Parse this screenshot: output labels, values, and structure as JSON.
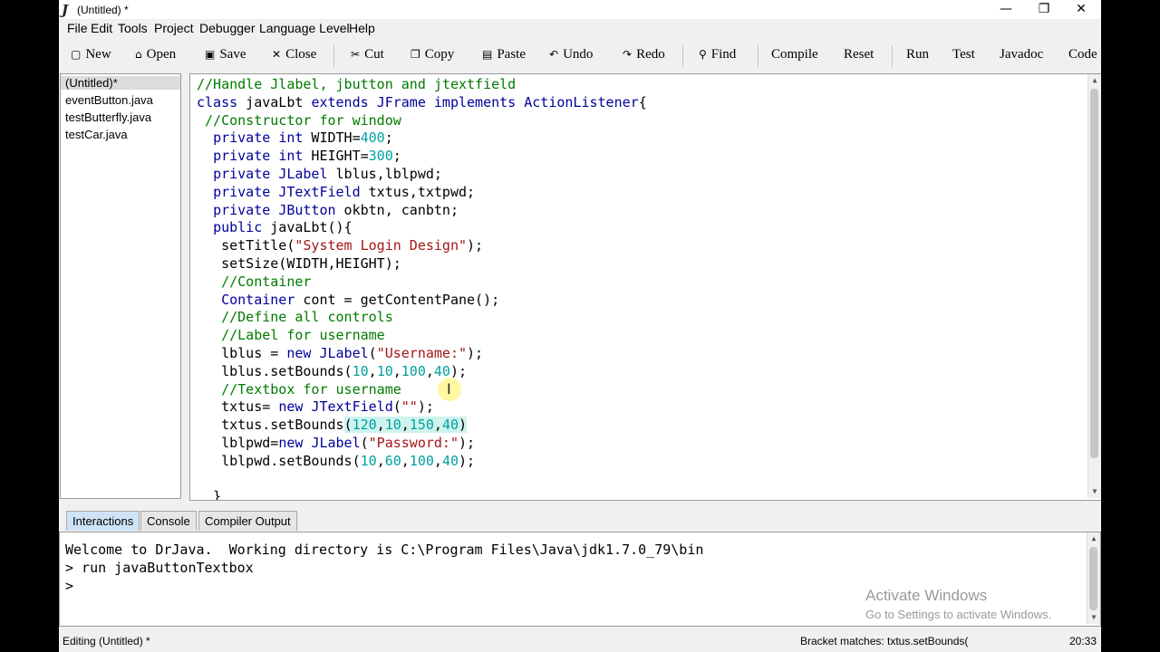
{
  "window": {
    "title": "(Untitled) *",
    "app_icon": "J",
    "controls": {
      "minimize": "—",
      "maximize": "❐",
      "close": "✕"
    }
  },
  "menu": [
    "File",
    "Edit",
    "Tools",
    "Project",
    "Debugger",
    "Language Level",
    "Help"
  ],
  "toolbar": {
    "new": "New",
    "open": "Open",
    "save": "Save",
    "close": "Close",
    "cut": "Cut",
    "copy": "Copy",
    "paste": "Paste",
    "undo": "Undo",
    "redo": "Redo",
    "find": "Find",
    "compile": "Compile",
    "reset": "Reset",
    "run": "Run",
    "test": "Test",
    "javadoc": "Javadoc",
    "code": "Code"
  },
  "documents": [
    "(Untitled)*",
    "eventButton.java",
    "testButterfly.java",
    "testCar.java"
  ],
  "editor": {
    "lines": [
      "//Handle Jlabel, jbutton and jtextfield",
      "class javaLbt extends JFrame implements ActionListener{",
      " //Constructor for window",
      "  private int WIDTH=400;",
      "  private int HEIGHT=300;",
      "  private JLabel lblus,lblpwd;",
      "  private JTextField txtus,txtpwd;",
      "  private JButton okbtn, canbtn;",
      "  public javaLbt(){",
      "   setTitle(\"System Login Design\");",
      "   setSize(WIDTH,HEIGHT);",
      "   //Container",
      "   Container cont = getContentPane();",
      "   //Define all controls",
      "   //Label for username",
      "   lblus = new JLabel(\"Username:\");",
      "   lblus.setBounds(10,10,100,40);",
      "   //Textbox for username",
      "   txtus= new JTextField(\"\");",
      "   txtus.setBounds(120,10,150,40)",
      "   lblpwd=new JLabel(\"Password:\");",
      "   lblpwd.setBounds(10,60,100,40);",
      "",
      "  }"
    ]
  },
  "bottom_tabs": [
    "Interactions",
    "Console",
    "Compiler Output"
  ],
  "interactions": {
    "lines": [
      "Welcome to DrJava.  Working directory is C:\\Program Files\\Java\\jdk1.7.0_79\\bin",
      "> run javaButtonTextbox",
      ">"
    ]
  },
  "watermark": {
    "title": "Activate Windows",
    "subtitle": "Go to Settings to activate Windows."
  },
  "status": {
    "editing": "Editing (Untitled) *",
    "bracket_label": "Bracket matches:",
    "bracket_value": "txtus.setBounds(",
    "position": "20:33"
  },
  "icons": {
    "new": "new-file-icon",
    "open": "open-folder-icon",
    "save": "save-disk-icon",
    "close": "close-x-icon",
    "cut": "scissors-icon",
    "copy": "copy-icon",
    "paste": "paste-icon",
    "undo": "undo-icon",
    "redo": "redo-icon",
    "find": "binoculars-icon"
  }
}
